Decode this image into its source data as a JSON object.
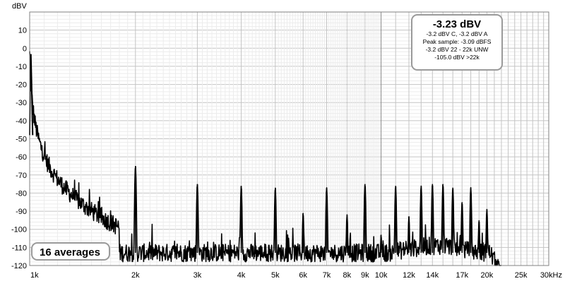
{
  "chart_data": {
    "type": "line",
    "ylabel": "dBV",
    "xlabel": "",
    "x_scale": "log",
    "xlim": [
      1000,
      30000
    ],
    "ylim": [
      -120,
      20
    ],
    "x_ticks": [
      {
        "value": 1000,
        "label": "1k"
      },
      {
        "value": 2000,
        "label": "2k"
      },
      {
        "value": 3000,
        "label": "3k"
      },
      {
        "value": 4000,
        "label": "4k"
      },
      {
        "value": 5000,
        "label": "5k"
      },
      {
        "value": 6000,
        "label": "6k"
      },
      {
        "value": 7000,
        "label": "7k"
      },
      {
        "value": 8000,
        "label": "8k"
      },
      {
        "value": 9000,
        "label": "9k"
      },
      {
        "value": 10000,
        "label": "10k"
      },
      {
        "value": 12000,
        "label": "12k"
      },
      {
        "value": 14000,
        "label": "14k"
      },
      {
        "value": 17000,
        "label": "17k"
      },
      {
        "value": 20000,
        "label": "20k"
      },
      {
        "value": 25000,
        "label": "25k"
      },
      {
        "value": 30000,
        "label": "30kHz"
      }
    ],
    "y_ticks": [
      10,
      0,
      -10,
      -20,
      -30,
      -40,
      -50,
      -60,
      -70,
      -80,
      -90,
      -100,
      -110,
      -120
    ],
    "grid": true,
    "fundamental": {
      "freq_hz": 1000,
      "level_dbv": -3.23
    },
    "harmonics": [
      {
        "freq_hz": 2000,
        "level_dbv": -65
      },
      {
        "freq_hz": 3000,
        "level_dbv": -75
      },
      {
        "freq_hz": 4000,
        "level_dbv": -76
      },
      {
        "freq_hz": 5000,
        "level_dbv": -77
      },
      {
        "freq_hz": 6000,
        "level_dbv": -91
      },
      {
        "freq_hz": 7000,
        "level_dbv": -77
      },
      {
        "freq_hz": 8000,
        "level_dbv": -92
      },
      {
        "freq_hz": 9000,
        "level_dbv": -75
      },
      {
        "freq_hz": 10000,
        "level_dbv": -103
      },
      {
        "freq_hz": 11000,
        "level_dbv": -76
      },
      {
        "freq_hz": 12000,
        "level_dbv": -93
      },
      {
        "freq_hz": 13000,
        "level_dbv": -76
      },
      {
        "freq_hz": 14000,
        "level_dbv": -75
      },
      {
        "freq_hz": 15000,
        "level_dbv": -75
      },
      {
        "freq_hz": 16000,
        "level_dbv": -77
      },
      {
        "freq_hz": 17000,
        "level_dbv": -85
      },
      {
        "freq_hz": 18000,
        "level_dbv": -77
      },
      {
        "freq_hz": 19000,
        "level_dbv": -95
      },
      {
        "freq_hz": 20000,
        "level_dbv": -89
      }
    ],
    "noise_floor_dbv": -113,
    "rolloff_hz": 21500,
    "cursor_freq_hz": 10000
  },
  "readout": {
    "level": "-3.23 dBV",
    "line1": "-3.2 dBV C, -3.2 dBV A",
    "line2": "Peak sample: -3.09 dBFS",
    "line3": "-3.2 dBV 22 - 22k UNW",
    "line4": "-105.0 dBV >22k"
  },
  "averages_label": "16 averages",
  "colors": {
    "trace": "#000000",
    "grid": "#dcdcdc",
    "major_grid": "#c4c4c4",
    "frame": "#808080"
  }
}
